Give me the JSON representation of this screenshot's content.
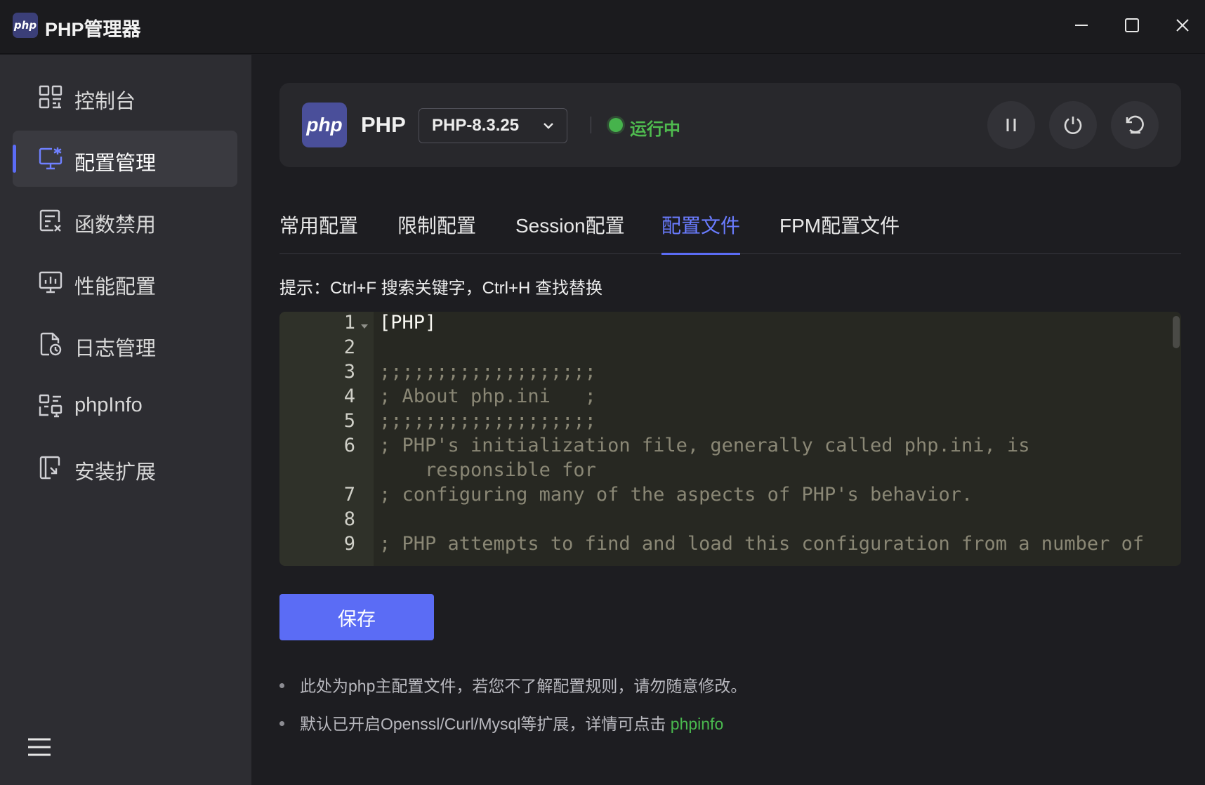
{
  "window": {
    "logo_text": "php",
    "title": "PHP管理器"
  },
  "sidebar": {
    "items": [
      {
        "label": "控制台",
        "icon": "dashboard-grid-icon"
      },
      {
        "label": "配置管理",
        "icon": "monitor-settings-icon"
      },
      {
        "label": "函数禁用",
        "icon": "function-disable-icon"
      },
      {
        "label": "性能配置",
        "icon": "performance-chart-icon"
      },
      {
        "label": "日志管理",
        "icon": "log-file-icon"
      },
      {
        "label": "phpInfo",
        "icon": "info-icon"
      },
      {
        "label": "安装扩展",
        "icon": "extension-icon"
      }
    ],
    "active_index": 1,
    "collapse_icon": "menu-collapse-icon"
  },
  "php_card": {
    "logo_text": "php",
    "name": "PHP",
    "version": "PHP-8.3.25",
    "status": "运行中",
    "status_color": "#46b34c"
  },
  "tabs": [
    {
      "label": "常用配置"
    },
    {
      "label": "限制配置"
    },
    {
      "label": "Session配置"
    },
    {
      "label": "配置文件"
    },
    {
      "label": "FPM配置文件"
    }
  ],
  "active_tab": 3,
  "hint": "提示：Ctrl+F 搜索关键字，Ctrl+H 查找替换",
  "editor": {
    "line_numbers": [
      "1",
      "2",
      "3",
      "4",
      "5",
      "6",
      "7",
      "8",
      "9"
    ],
    "lines": [
      "[PHP]",
      "",
      ";;;;;;;;;;;;;;;;;;;",
      "; About php.ini   ;",
      ";;;;;;;;;;;;;;;;;;;",
      "; PHP's initialization file, generally called php.ini, is",
      "    responsible for",
      "; configuring many of the aspects of PHP's behavior.",
      "",
      "; PHP attempts to find and load this configuration from a number of"
    ]
  },
  "save_label": "保存",
  "notes": {
    "first": "此处为php主配置文件，若您不了解配置规则，请勿随意修改。",
    "second": "默认已开启Openssl/Curl/Mysql等扩展，详情可点击 ",
    "second_link": "phpinfo"
  },
  "colors": {
    "accent": "#5b6cf5",
    "running": "#46b34c",
    "link": "#49b84e"
  }
}
